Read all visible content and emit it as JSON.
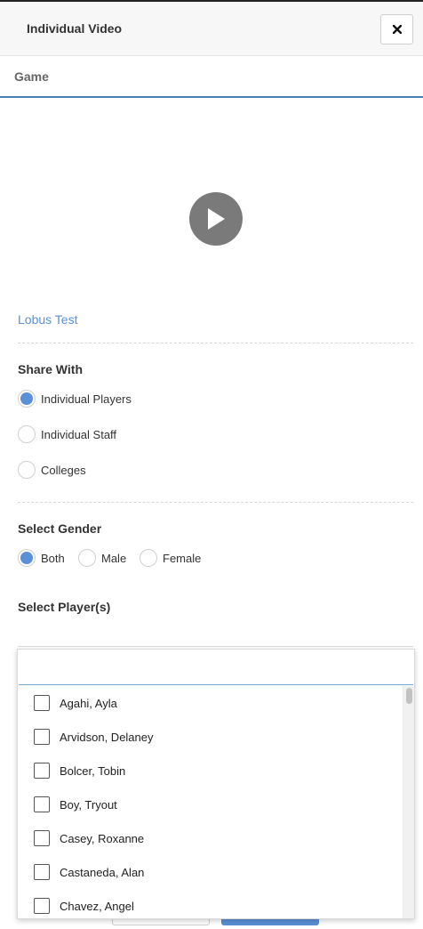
{
  "header": {
    "title": "Individual Video",
    "close_icon": "close-icon"
  },
  "subheader": {
    "label": "Game"
  },
  "video": {
    "play_icon": "play-icon",
    "title": "Lobus Test"
  },
  "share_with": {
    "label": "Share With",
    "options": [
      "Individual Players",
      "Individual Staff",
      "Colleges"
    ],
    "selected": "Individual Players"
  },
  "gender": {
    "label": "Select Gender",
    "options": [
      "Both",
      "Male",
      "Female"
    ],
    "selected": "Both"
  },
  "players": {
    "label": "Select Player(s)",
    "search_value": "",
    "items": [
      "Agahi, Ayla",
      "Arvidson, Delaney",
      "Bolcer, Tobin",
      "Boy, Tryout",
      "Casey, Roxanne",
      "Castaneda, Alan",
      "Chavez, Angel"
    ]
  },
  "colors": {
    "accent": "#5b8fd6",
    "play_button": "#7a7a7a",
    "header_bg": "#f7f7f7"
  }
}
